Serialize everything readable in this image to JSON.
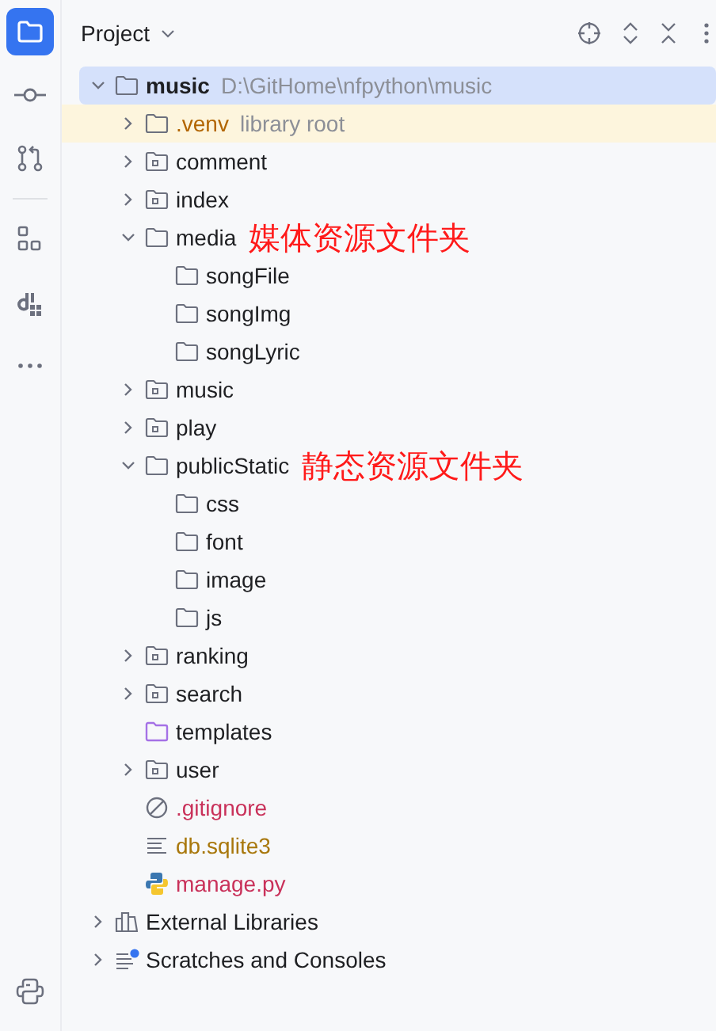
{
  "sidebar": {
    "tools": [
      {
        "kind": "project",
        "selected": true
      },
      {
        "kind": "commit",
        "selected": false
      },
      {
        "kind": "pull-requests",
        "selected": false
      },
      {
        "kind": "structure",
        "selected": false
      },
      {
        "kind": "di",
        "selected": false
      },
      {
        "kind": "more",
        "selected": false
      }
    ],
    "bottom_tools": [
      {
        "kind": "python",
        "selected": false
      }
    ]
  },
  "panel": {
    "title": "Project",
    "toolbar": [
      {
        "kind": "locate"
      },
      {
        "kind": "expand"
      },
      {
        "kind": "collapse"
      },
      {
        "kind": "options"
      }
    ]
  },
  "tree": [
    {
      "label": "music",
      "path": "D:\\GitHome\\nfpython\\music",
      "kind": "folder",
      "bold": true,
      "expanded": true,
      "selected": true,
      "children": [
        {
          "label": ".venv",
          "note": "library root",
          "kind": "library-folder",
          "expanded": false,
          "selected": false,
          "color": "#b26500"
        },
        {
          "label": "comment",
          "kind": "package",
          "expanded": false,
          "selected": false
        },
        {
          "label": "index",
          "kind": "package",
          "expanded": false,
          "selected": false
        },
        {
          "label": "media",
          "kind": "folder",
          "expanded": true,
          "selected": false,
          "annotation": "媒体资源文件夹",
          "children": [
            {
              "label": "songFile",
              "kind": "folder",
              "selected": false
            },
            {
              "label": "songImg",
              "kind": "folder",
              "selected": false
            },
            {
              "label": "songLyric",
              "kind": "folder",
              "selected": false
            }
          ]
        },
        {
          "label": "music",
          "kind": "package",
          "expanded": false,
          "selected": false
        },
        {
          "label": "play",
          "kind": "package",
          "expanded": false,
          "selected": false
        },
        {
          "label": "publicStatic",
          "kind": "folder",
          "expanded": true,
          "selected": false,
          "annotation": "静态资源文件夹",
          "children": [
            {
              "label": "css",
              "kind": "folder",
              "selected": false
            },
            {
              "label": "font",
              "kind": "folder",
              "selected": false
            },
            {
              "label": "image",
              "kind": "folder",
              "selected": false
            },
            {
              "label": "js",
              "kind": "folder",
              "selected": false
            }
          ]
        },
        {
          "label": "ranking",
          "kind": "package",
          "expanded": false,
          "selected": false
        },
        {
          "label": "search",
          "kind": "package",
          "expanded": false,
          "selected": false
        },
        {
          "label": "templates",
          "kind": "templates-folder",
          "selected": false
        },
        {
          "label": "user",
          "kind": "package",
          "expanded": false,
          "selected": false
        },
        {
          "label": ".gitignore",
          "kind": "ignore-file",
          "selected": false,
          "color": "#c9315a"
        },
        {
          "label": "db.sqlite3",
          "kind": "text-file",
          "selected": false,
          "color": "#a8770b"
        },
        {
          "label": "manage.py",
          "kind": "python-file",
          "selected": false,
          "color": "#c9315a"
        }
      ]
    },
    {
      "label": "External Libraries",
      "kind": "libraries",
      "expanded": false,
      "selected": false
    },
    {
      "label": "Scratches and Consoles",
      "kind": "scratches",
      "expanded": false,
      "selected": false
    }
  ]
}
